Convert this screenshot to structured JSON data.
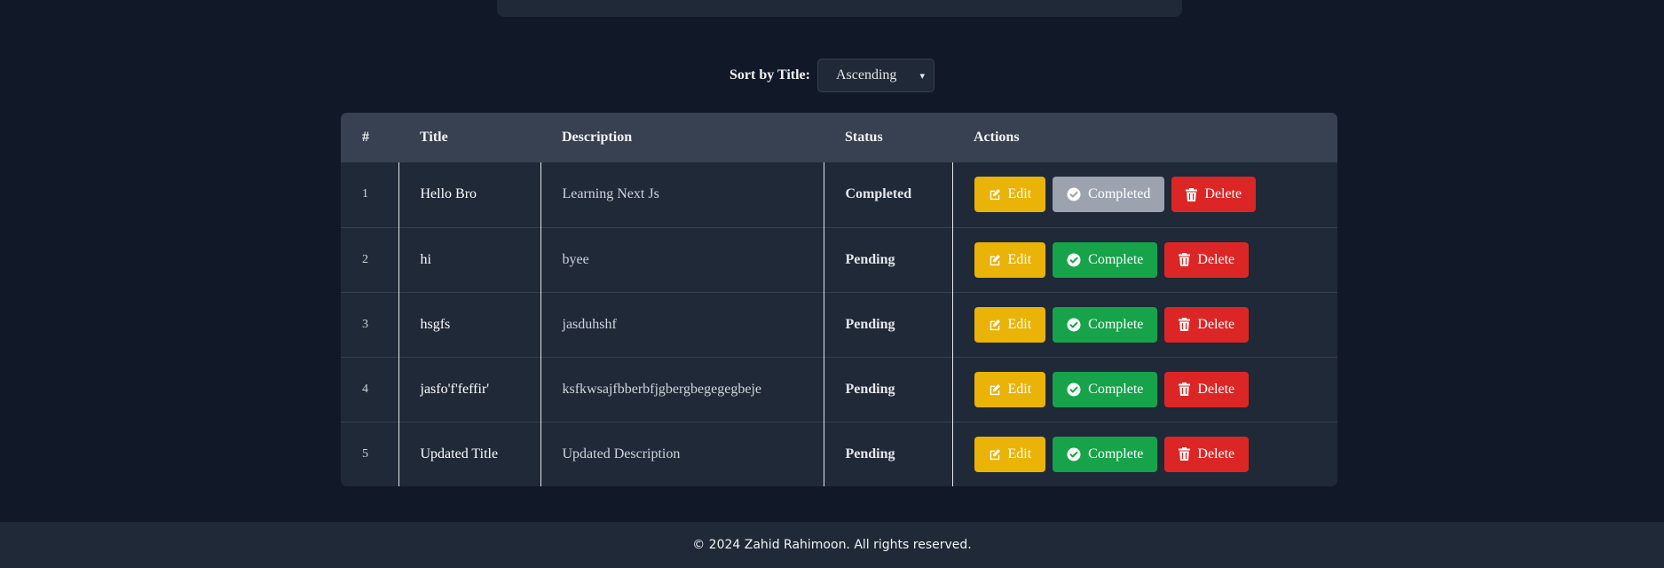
{
  "sort": {
    "label": "Sort by Title:",
    "selected": "Ascending",
    "chevron": "▾"
  },
  "table": {
    "headers": [
      "#",
      "Title",
      "Description",
      "Status",
      "Actions"
    ],
    "rows": [
      {
        "num": "1",
        "title": "Hello Bro",
        "description": "Learning Next Js",
        "status": "Completed",
        "complete_label": "Completed"
      },
      {
        "num": "2",
        "title": "hi",
        "description": "byee",
        "status": "Pending",
        "complete_label": "Complete"
      },
      {
        "num": "3",
        "title": "hsgfs",
        "description": "jasduhshf",
        "status": "Pending",
        "complete_label": "Complete"
      },
      {
        "num": "4",
        "title": "jasfo'f'feffir'",
        "description": "ksfkwsajfbberbfjgbergbegegegbeje",
        "status": "Pending",
        "complete_label": "Complete"
      },
      {
        "num": "5",
        "title": "Updated Title",
        "description": "Updated Description",
        "status": "Pending",
        "complete_label": "Complete"
      }
    ],
    "edit_label": "Edit",
    "delete_label": "Delete"
  },
  "footer": {
    "text": "© 2024 Zahid Rahimoon. All rights reserved."
  },
  "colors": {
    "background": "#111827",
    "card": "#1f2937",
    "header": "#374151",
    "edit": "#eab308",
    "complete": "#16a34a",
    "completed_button": "#9ca3af",
    "delete": "#dc2626",
    "status_completed": "#4ade80"
  },
  "icons": {
    "edit": "edit-icon",
    "complete": "check-circle-icon",
    "delete": "trash-icon",
    "dropdown": "chevron-down-icon"
  }
}
